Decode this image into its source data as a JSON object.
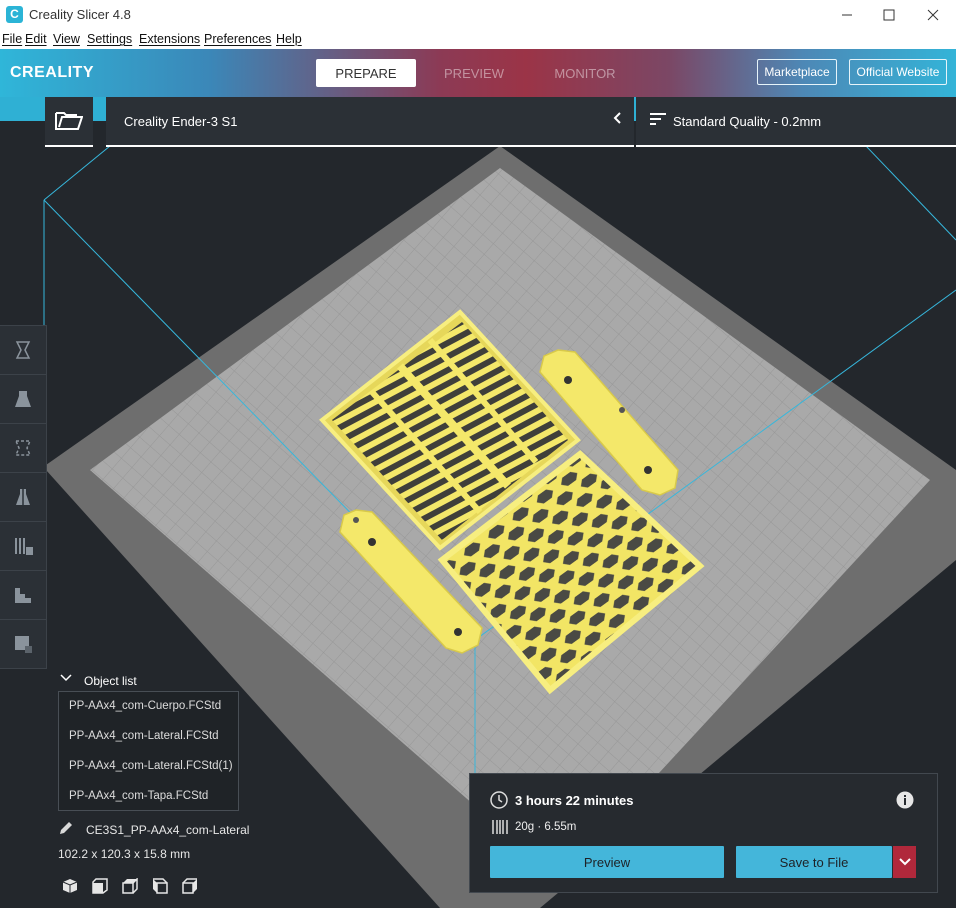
{
  "window": {
    "title": "Creality Slicer 4.8",
    "controls": [
      "minimize-icon",
      "maximize-icon",
      "close-icon"
    ]
  },
  "menu": {
    "items": [
      "File",
      "Edit",
      "View",
      "Settings",
      "Extensions",
      "Preferences",
      "Help"
    ]
  },
  "header": {
    "brand": "CREALITY",
    "stages": [
      "PREPARE",
      "PREVIEW",
      "MONITOR"
    ],
    "active_stage": "PREPARE",
    "marketplace_label": "Marketplace",
    "website_label": "Official Website"
  },
  "printer": {
    "name": "Creality Ender-3 S1"
  },
  "quality": {
    "label": "Standard Quality - 0.2mm"
  },
  "tools": [
    "move-tool-icon",
    "scale-tool-icon",
    "rotate-tool-icon",
    "mirror-tool-icon",
    "per-model-settings-icon",
    "support-blocker-icon",
    "custom-supports-icon"
  ],
  "object_list": {
    "header": "Object list",
    "items": [
      "PP-AAx4_com-Cuerpo.FCStd",
      "PP-AAx4_com-Lateral.FCStd",
      "PP-AAx4_com-Lateral.FCStd(1)",
      "PP-AAx4_com-Tapa.FCStd"
    ]
  },
  "selection": {
    "name": "CE3S1_PP-AAx4_com-Lateral",
    "dimensions": "102.2 x 120.3 x 15.8 mm"
  },
  "view_buttons": [
    "view-3d-icon",
    "view-front-icon",
    "view-top-icon",
    "view-left-icon",
    "view-right-icon"
  ],
  "print_info": {
    "time": "3 hours 22 minutes",
    "material": "20g · 6.55m",
    "preview_label": "Preview",
    "save_label": "Save to File"
  },
  "colors": {
    "accent": "#44b6da",
    "save_dropdown": "#b0283b",
    "model": "#f4e86a",
    "background": "#23272c"
  }
}
